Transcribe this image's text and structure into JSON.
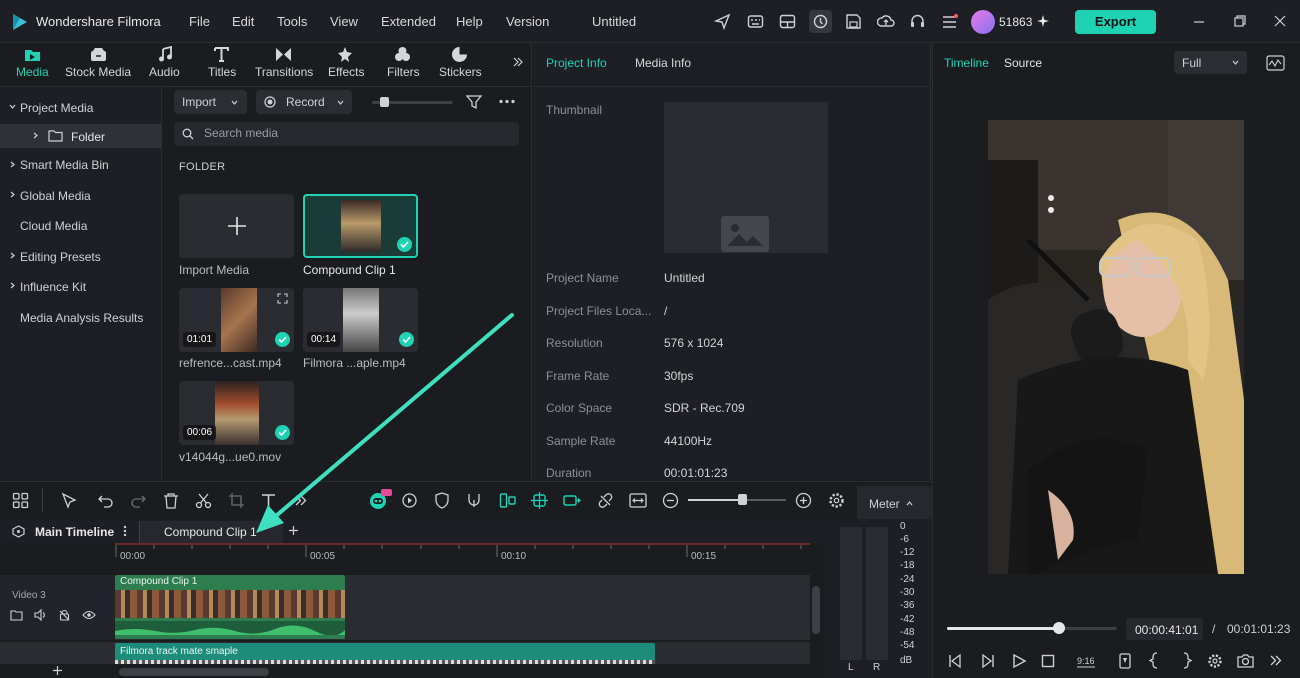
{
  "app": {
    "name": "Wondershare Filmora",
    "doc_title": "Untitled",
    "credits": "51863",
    "export_label": "Export"
  },
  "menu": [
    "File",
    "Edit",
    "Tools",
    "View",
    "Extended",
    "Help",
    "Version"
  ],
  "media_tabs": [
    "Media",
    "Stock Media",
    "Audio",
    "Titles",
    "Transitions",
    "Effects",
    "Filters",
    "Stickers"
  ],
  "sidebar": [
    "Project Media",
    "Folder",
    "Smart Media Bin",
    "Global Media",
    "Cloud Media",
    "Editing Presets",
    "Influence Kit",
    "Media Analysis Results"
  ],
  "toolbar": {
    "import_label": "Import",
    "record_label": "Record",
    "search_placeholder": "Search media",
    "folder_heading": "FOLDER"
  },
  "media_items": [
    {
      "label": "Import Media"
    },
    {
      "label": "Compound Clip 1"
    },
    {
      "label": "refrence...cast.mp4",
      "duration": "01:01"
    },
    {
      "label": "Filmora ...aple.mp4",
      "duration": "00:14"
    },
    {
      "label": "v14044g...ue0.mov",
      "duration": "00:06"
    }
  ],
  "info_tabs": [
    "Project Info",
    "Media Info"
  ],
  "project_info": {
    "thumbnail_label": "Thumbnail",
    "rows": [
      {
        "key": "Project Name",
        "value": "Untitled"
      },
      {
        "key": "Project Files Loca...",
        "value": "/"
      },
      {
        "key": "Resolution",
        "value": "576 x 1024"
      },
      {
        "key": "Frame Rate",
        "value": "30fps"
      },
      {
        "key": "Color Space",
        "value": "SDR - Rec.709"
      },
      {
        "key": "Sample Rate",
        "value": "44100Hz"
      },
      {
        "key": "Duration",
        "value": "00:01:01:23"
      }
    ]
  },
  "preview": {
    "tabs": [
      "Timeline",
      "Source"
    ],
    "quality": "Full",
    "current_time": "00:00:41:01",
    "separator": "/",
    "total_time": "00:01:01:23",
    "playhead_fraction": 0.66
  },
  "timeline": {
    "tabs": [
      "Main Timeline",
      "Compound Clip 1"
    ],
    "meter_label": "Meter",
    "ruler": [
      "00:00",
      "00:05",
      "00:10",
      "00:15"
    ],
    "track_name": "Video 3",
    "clips": [
      "Compound Clip 1",
      "Filmora track mate smaple"
    ],
    "zoom_fraction": 0.55
  },
  "meter": {
    "db_scale": [
      "0",
      "-6",
      "-12",
      "-18",
      "-24",
      "-30",
      "-36",
      "-42",
      "-48",
      "-54",
      "dB"
    ],
    "channels": [
      "L",
      "R"
    ]
  },
  "colors": {
    "accent": "#1ed3b4",
    "clip_green": "#2e7d4f",
    "clip_teal": "#1e8c7a"
  }
}
